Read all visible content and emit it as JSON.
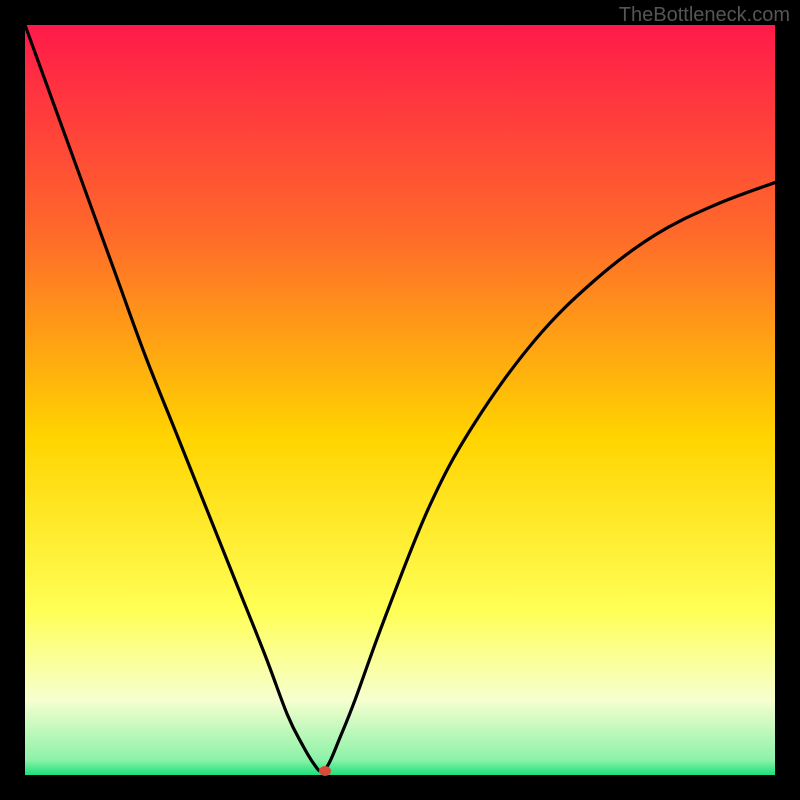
{
  "watermark": "TheBottleneck.com",
  "colors": {
    "top": "#ff1a4a",
    "mid_upper": "#ff6a2a",
    "mid": "#ffd400",
    "mid_lower": "#ffff66",
    "pale": "#f6ffcf",
    "bottom": "#1be07a",
    "curve": "#000000",
    "marker": "#d84b3a",
    "frame": "#000000"
  },
  "chart_data": {
    "type": "line",
    "title": "",
    "xlabel": "",
    "ylabel": "",
    "xlim": [
      0,
      100
    ],
    "ylim": [
      0,
      100
    ],
    "series": [
      {
        "name": "bottleneck-curve",
        "x": [
          0,
          4,
          8,
          12,
          16,
          20,
          24,
          28,
          32,
          35,
          37,
          38.5,
          39.5,
          40.5,
          42,
          44,
          48,
          54,
          60,
          68,
          76,
          84,
          92,
          100
        ],
        "y": [
          100,
          89,
          78,
          67,
          56,
          46,
          36,
          26,
          16,
          8,
          4,
          1.5,
          0.5,
          1.5,
          5,
          10,
          21,
          36,
          47,
          58,
          66,
          72,
          76,
          79
        ]
      }
    ],
    "marker": {
      "x": 40.0,
      "y": 0.5,
      "color": "#d84b3a"
    },
    "gradient_stops": [
      {
        "offset": 0,
        "color": "#ff1a4a"
      },
      {
        "offset": 28,
        "color": "#ff6a2a"
      },
      {
        "offset": 55,
        "color": "#ffd400"
      },
      {
        "offset": 78,
        "color": "#ffff55"
      },
      {
        "offset": 90,
        "color": "#f6ffcf"
      },
      {
        "offset": 98,
        "color": "#8cf2a8"
      },
      {
        "offset": 100,
        "color": "#1be07a"
      }
    ]
  }
}
